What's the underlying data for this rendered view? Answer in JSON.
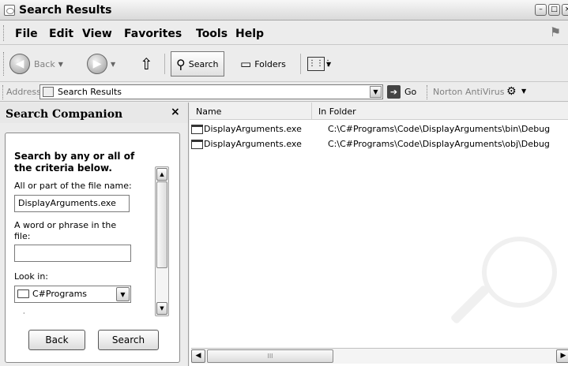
{
  "window": {
    "title": "Search Results"
  },
  "menu": [
    "File",
    "Edit",
    "View",
    "Favorites",
    "Tools",
    "Help"
  ],
  "toolbar": {
    "back_label": "Back",
    "search_label": "Search",
    "folders_label": "Folders"
  },
  "address": {
    "label": "Address",
    "value": "Search Results",
    "go_label": "Go",
    "norton_label": "Norton AntiVirus"
  },
  "companion": {
    "title": "Search Companion",
    "close_glyph": "×",
    "heading": "Search by any or all of the criteria below.",
    "filename_label": "All or part of the file name:",
    "filename_value": "DisplayArguments.exe",
    "phrase_label": "A word or phrase in the file:",
    "phrase_value": "",
    "lookin_label": "Look in:",
    "lookin_value": "C#Programs",
    "back_button": "Back",
    "search_button": "Search"
  },
  "results": {
    "columns": [
      "Name",
      "In Folder"
    ],
    "rows": [
      {
        "name": "DisplayArguments.exe",
        "folder": "C:\\C#Programs\\Code\\DisplayArguments\\bin\\Debug"
      },
      {
        "name": "DisplayArguments.exe",
        "folder": "C:\\C#Programs\\Code\\DisplayArguments\\obj\\Debug"
      }
    ],
    "hscroll_grip": "III"
  }
}
